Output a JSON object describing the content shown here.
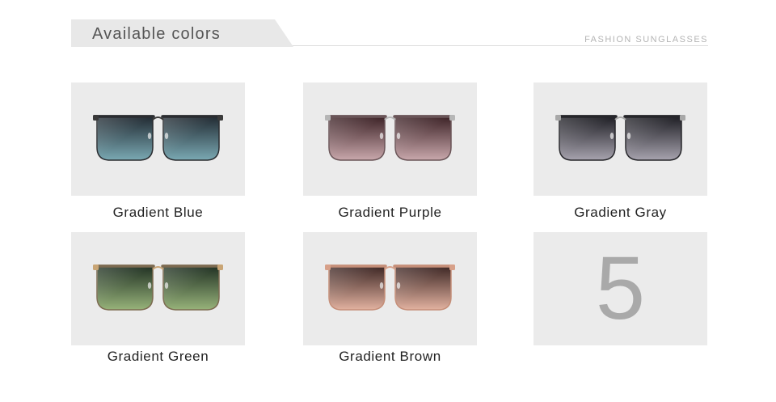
{
  "header": {
    "title": "Available colors",
    "subtitle": "FASHION SUNGLASSES"
  },
  "products": [
    {
      "label": "Gradient Blue",
      "lens_top": "#202830",
      "lens_bottom": "#7aa9b3",
      "frame": "#2a2c30",
      "temple": "#3a3a3a"
    },
    {
      "label": "Gradient Purple",
      "lens_top": "#3a2024",
      "lens_bottom": "#c9a8ac",
      "frame": "#6a5558",
      "temple": "#b6b6b6"
    },
    {
      "label": "Gradient Gray",
      "lens_top": "#1c1c22",
      "lens_bottom": "#a7a3ae",
      "frame": "#26262a",
      "temple": "#a8a8a8"
    },
    {
      "label": "Gradient Green",
      "lens_top": "#1f2f22",
      "lens_bottom": "#97b37a",
      "frame": "#7c6a50",
      "temple": "#c9a575"
    },
    {
      "label": "Gradient Brown",
      "lens_top": "#3a2422",
      "lens_bottom": "#e2b2a0",
      "frame": "#c58e78",
      "temple": "#d7a089"
    }
  ],
  "count_tile": {
    "number": "5"
  }
}
